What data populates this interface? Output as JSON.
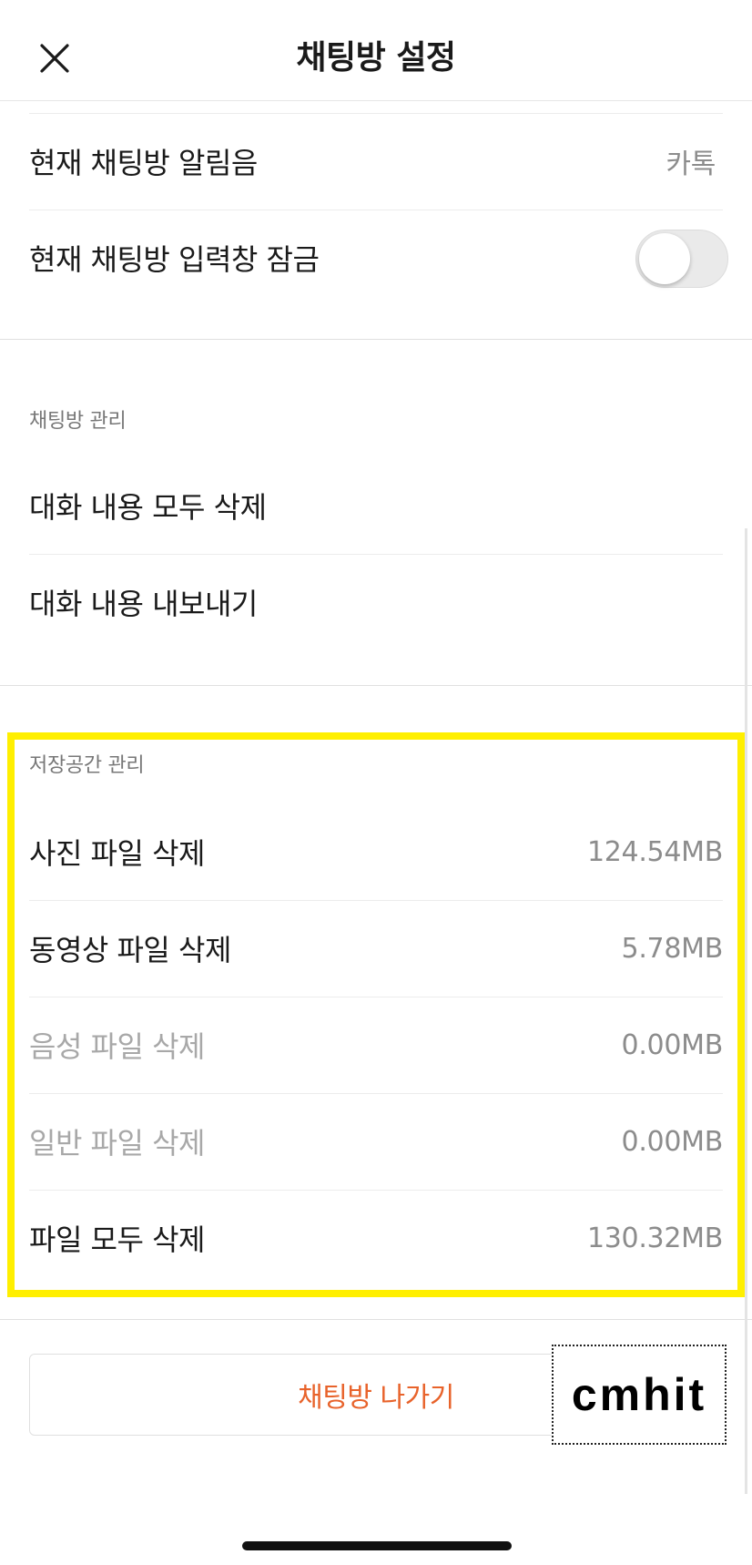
{
  "header": {
    "title": "채팅방 설정",
    "close_icon": "close-icon"
  },
  "notification": {
    "sound_label": "현재 채팅방 알림음",
    "sound_value": "카톡",
    "lock_label": "현재 채팅방 입력창 잠금",
    "lock_enabled": false
  },
  "management": {
    "heading": "채팅방 관리",
    "items": [
      {
        "label": "대화 내용 모두 삭제"
      },
      {
        "label": "대화 내용 내보내기"
      }
    ]
  },
  "storage": {
    "heading": "저장공간 관리",
    "items": [
      {
        "label": "사진 파일 삭제",
        "value": "124.54MB",
        "enabled": true
      },
      {
        "label": "동영상 파일 삭제",
        "value": "5.78MB",
        "enabled": true
      },
      {
        "label": "음성 파일 삭제",
        "value": "0.00MB",
        "enabled": false
      },
      {
        "label": "일반 파일 삭제",
        "value": "0.00MB",
        "enabled": false
      },
      {
        "label": "파일 모두 삭제",
        "value": "130.32MB",
        "enabled": true
      }
    ],
    "highlight_color": "#ffef00"
  },
  "leave": {
    "label": "채팅방 나가기",
    "color": "#e8632b"
  },
  "watermark": {
    "text": "cmhit"
  }
}
